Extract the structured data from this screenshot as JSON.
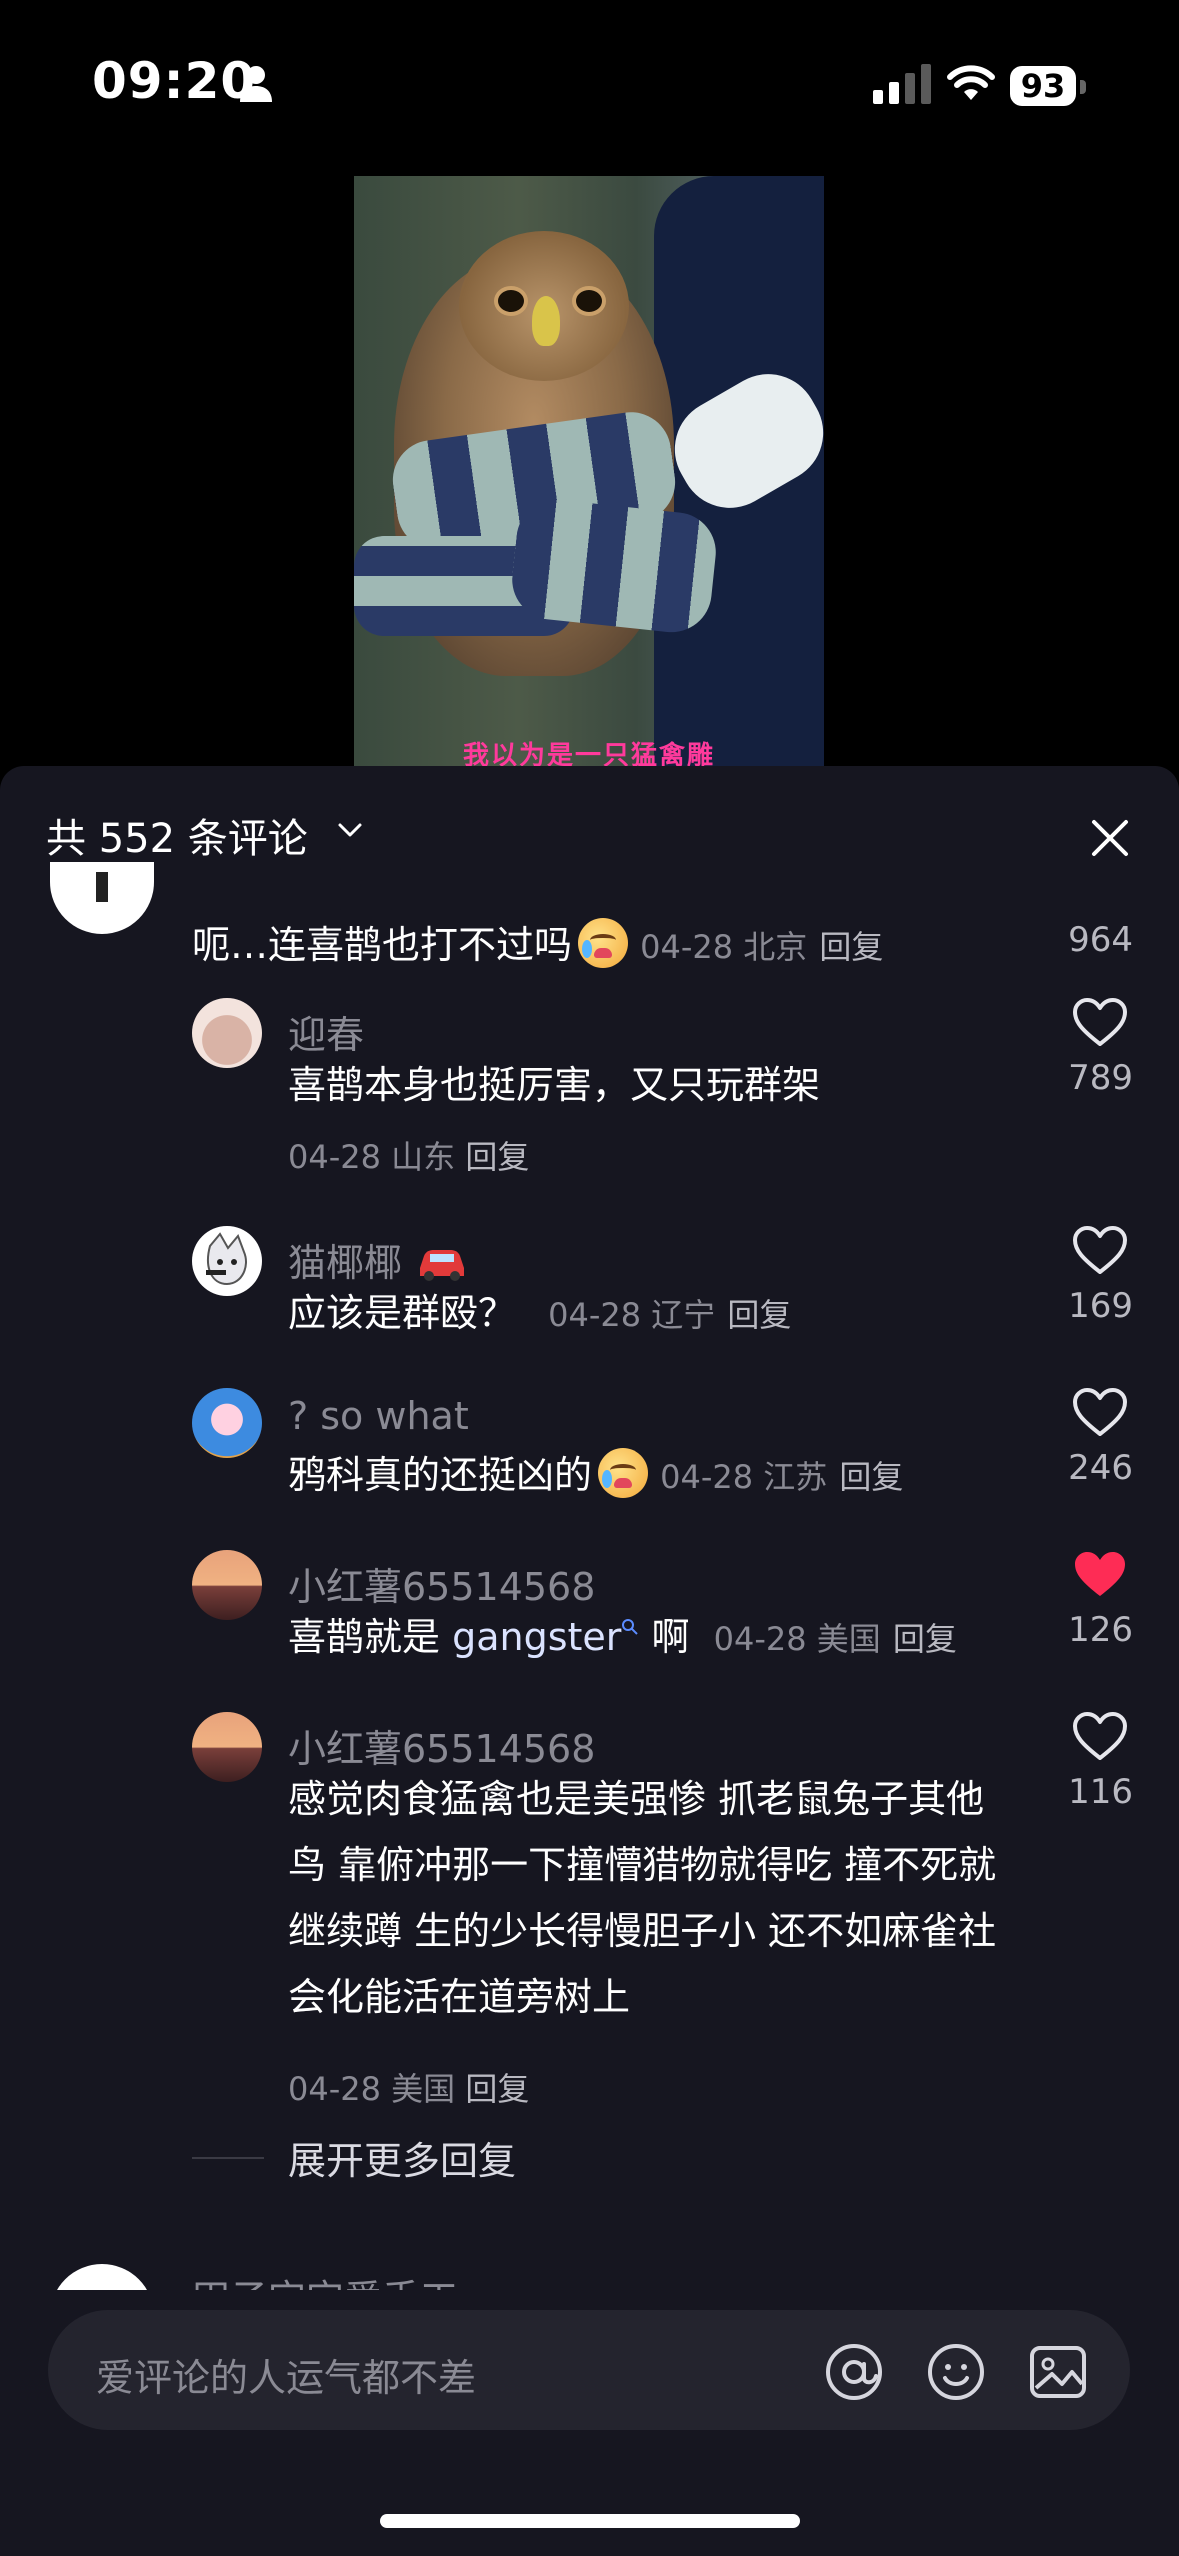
{
  "status_bar": {
    "time": "09:20",
    "battery": "93"
  },
  "video": {
    "caption": "我以为是一只猛禽雕"
  },
  "comments": {
    "header": "共 552 条评论",
    "top_comment": {
      "text": "呃…连喜鹊也打不过吗",
      "meta": "04-28 北京",
      "reply_label": "回复",
      "likes": "964"
    },
    "replies": [
      {
        "name": "迎春",
        "text": "喜鹊本身也挺厉害，又只玩群架",
        "meta": "04-28 山东",
        "reply_label": "回复",
        "likes": "789",
        "liked": false
      },
      {
        "name": "猫椰椰",
        "text": "应该是群殴？",
        "meta": "04-28 辽宁",
        "reply_label": "回复",
        "likes": "169",
        "liked": false
      },
      {
        "name": "? so what",
        "text": "鸦科真的还挺凶的",
        "meta": "04-28 江苏",
        "reply_label": "回复",
        "likes": "246",
        "liked": false
      },
      {
        "name": "小红薯65514568",
        "text_before": "喜鹊就是 ",
        "text_link": "gangster",
        "text_after": " 啊",
        "meta": "04-28 美国",
        "reply_label": "回复",
        "likes": "126",
        "liked": true
      },
      {
        "name": "小红薯65514568",
        "text": "感觉肉食猛禽也是美强惨 抓老鼠兔子其他鸟 靠俯冲那一下撞懵猎物就得吃 撞不死就继续蹲 生的少长得慢胆子小 还不如麻雀社会化能活在道旁树上",
        "meta": "04-28 美国",
        "reply_label": "回复",
        "likes": "116",
        "liked": false
      }
    ],
    "expand_more": "展开更多回复",
    "next_comment_name": "田子宝宝爱手工"
  },
  "input": {
    "placeholder": "爱评论的人运气都不差"
  },
  "colors": {
    "sheet_bg": "#161620",
    "like_active": "#fe2c55",
    "meta_gray": "#8a8a94"
  }
}
